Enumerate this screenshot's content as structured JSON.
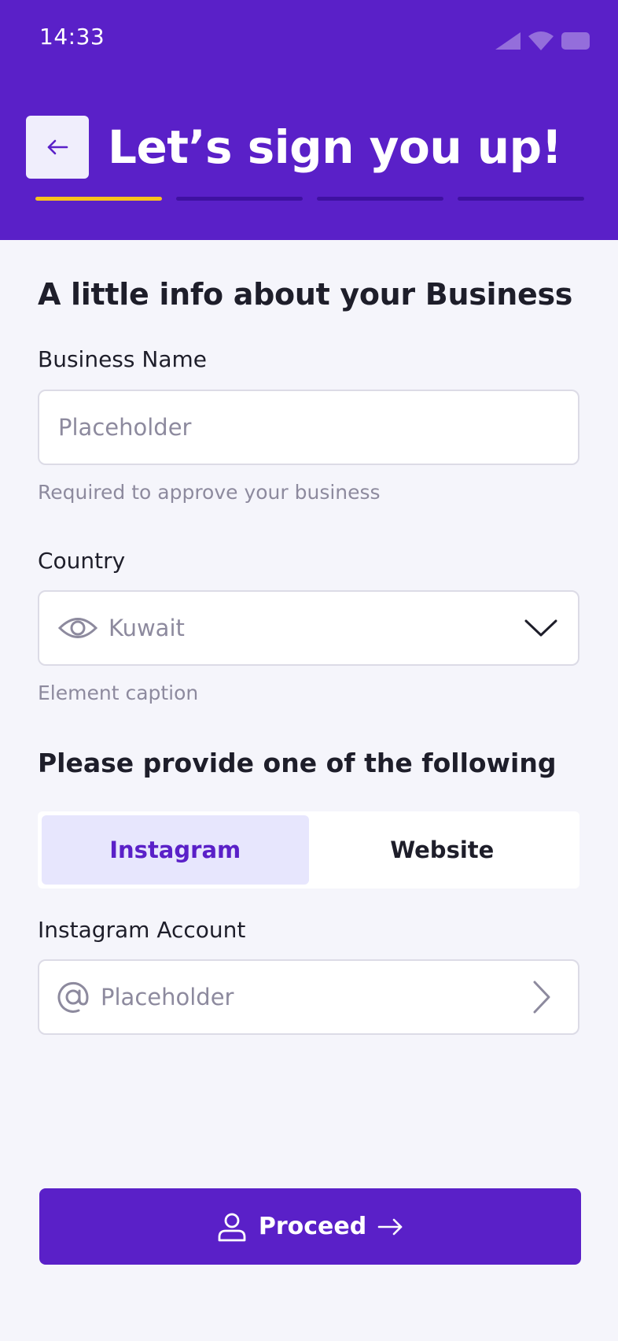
{
  "status_bar": {
    "time": "14:33",
    "icons": [
      "signal-icon",
      "wifi-icon",
      "battery-icon"
    ]
  },
  "header": {
    "title": "Let’s sign you up!",
    "back_icon": "arrow-left-icon",
    "progress": {
      "total_steps": 4,
      "current_step": 1
    }
  },
  "form": {
    "section_title": "A little info about your Business",
    "business_name": {
      "label": "Business Name",
      "placeholder": "Placeholder",
      "value": "",
      "caption": "Required to approve your business"
    },
    "country": {
      "label": "Country",
      "selected": "Kuwait",
      "caption": "Element caption",
      "leading_icon": "eye-icon",
      "trailing_icon": "chevron-down-icon"
    },
    "provide_title": "Please provide one of the following",
    "tabs": [
      {
        "label": "Instagram",
        "selected": true
      },
      {
        "label": "Website",
        "selected": false
      }
    ],
    "instagram": {
      "label": "Instagram Account",
      "placeholder": "Placeholder",
      "value": "",
      "leading_icon": "at-sign-icon",
      "trailing_icon": "chevron-right-icon"
    }
  },
  "footer": {
    "proceed_label": "Proceed",
    "leading_icon": "user-icon",
    "trailing_icon": "arrow-right-icon"
  },
  "colors": {
    "primary": "#5a20c8",
    "progress_active": "#f8c21c",
    "progress_inactive": "#3f11a1",
    "background": "#f5f5fb",
    "tab_selected_bg": "#e7e6fd",
    "muted_text": "#8d8a9e"
  }
}
